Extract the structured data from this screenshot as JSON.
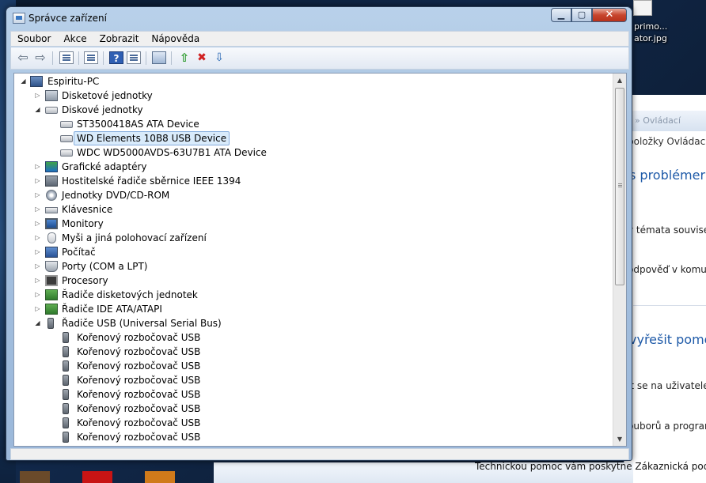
{
  "window": {
    "title": "Správce zařízení",
    "buttons": {
      "minimize": "▁",
      "maximize": "▢",
      "close": "✕"
    }
  },
  "menubar": [
    "Soubor",
    "Akce",
    "Zobrazit",
    "Nápověda"
  ],
  "toolbar": {
    "icons": [
      "back-icon",
      "forward-icon",
      "show-hide-console-tree-icon",
      "properties-icon",
      "help-icon",
      "action-pane-icon",
      "scan-hardware-icon",
      "update-driver-icon",
      "uninstall-icon",
      "disable-icon"
    ]
  },
  "tree": {
    "root": "Espiritu-PC",
    "items": [
      {
        "label": "Disketové jednotky",
        "icon": "floppy-icon",
        "level": 1,
        "expanded": false
      },
      {
        "label": "Diskové jednotky",
        "icon": "disk-drive-icon",
        "level": 1,
        "expanded": true
      },
      {
        "label": "ST3500418AS ATA Device",
        "icon": "disk-drive-icon",
        "level": 2
      },
      {
        "label": "WD Elements 10B8 USB Device",
        "icon": "disk-drive-icon",
        "level": 2,
        "selected": true
      },
      {
        "label": "WDC WD5000AVDS-63U7B1 ATA Device",
        "icon": "disk-drive-icon",
        "level": 2
      },
      {
        "label": "Grafické adaptéry",
        "icon": "display-adapter-icon",
        "level": 1,
        "expanded": false
      },
      {
        "label": "Hostitelské řadiče sběrnice IEEE 1394",
        "icon": "ieee1394-icon",
        "level": 1,
        "expanded": false
      },
      {
        "label": "Jednotky DVD/CD-ROM",
        "icon": "dvd-icon",
        "level": 1,
        "expanded": false
      },
      {
        "label": "Klávesnice",
        "icon": "keyboard-icon",
        "level": 1,
        "expanded": false
      },
      {
        "label": "Monitory",
        "icon": "monitor-icon",
        "level": 1,
        "expanded": false
      },
      {
        "label": "Myši a jiná polohovací zařízení",
        "icon": "mouse-icon",
        "level": 1,
        "expanded": false
      },
      {
        "label": "Počítač",
        "icon": "computer-icon",
        "level": 1,
        "expanded": false
      },
      {
        "label": "Porty (COM a LPT)",
        "icon": "port-icon",
        "level": 1,
        "expanded": false
      },
      {
        "label": "Procesory",
        "icon": "cpu-icon",
        "level": 1,
        "expanded": false
      },
      {
        "label": "Řadiče disketových jednotek",
        "icon": "controller-icon",
        "level": 1,
        "expanded": false
      },
      {
        "label": "Řadiče IDE ATA/ATAPI",
        "icon": "controller-icon",
        "level": 1,
        "expanded": false
      },
      {
        "label": "Řadiče USB (Universal Serial Bus)",
        "icon": "usb-icon",
        "level": 1,
        "expanded": true
      },
      {
        "label": "Kořenový rozbočovač USB",
        "icon": "usb-icon",
        "level": 2
      },
      {
        "label": "Kořenový rozbočovač USB",
        "icon": "usb-icon",
        "level": 2
      },
      {
        "label": "Kořenový rozbočovač USB",
        "icon": "usb-icon",
        "level": 2
      },
      {
        "label": "Kořenový rozbočovač USB",
        "icon": "usb-icon",
        "level": 2
      },
      {
        "label": "Kořenový rozbočovač USB",
        "icon": "usb-icon",
        "level": 2
      },
      {
        "label": "Kořenový rozbočovač USB",
        "icon": "usb-icon",
        "level": 2
      },
      {
        "label": "Kořenový rozbočovač USB",
        "icon": "usb-icon",
        "level": 2
      },
      {
        "label": "Kořenový rozbočovač USB",
        "icon": "usb-icon",
        "level": 2
      }
    ]
  },
  "background": {
    "desktop_icon_label_1": "primo...",
    "desktop_icon_label_2": "ator.jpg",
    "control_panel_address": "» Ovládací",
    "control_panel_lines": [
      "položky Ovládacíc",
      "s problémer",
      "y témata souvisejí",
      "odpověď v komu",
      "vyřešit pomo",
      "it se na uživatele,",
      "ouborů a prograr"
    ],
    "bottom_text": "Technickou pomoc vám poskytne Zákaznická podpora"
  },
  "colors": {
    "selection_bg": "#d9ebfb",
    "selection_border": "#84acdd",
    "link_blue": "#1e5aa8",
    "close_button": "#c7452d"
  }
}
